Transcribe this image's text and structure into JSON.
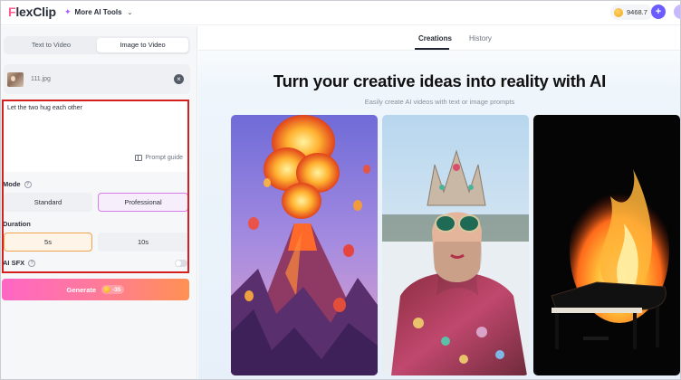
{
  "app": {
    "logo_prefix": "F",
    "logo_text": "lexClip",
    "tools_label": "More AI Tools",
    "credits": "9468.7",
    "icons": [
      "sparkle-icon",
      "chevron-down-icon",
      "coin-icon",
      "plus-icon"
    ]
  },
  "left_panel": {
    "tabs": [
      {
        "label": "Text to Video",
        "active": false
      },
      {
        "label": "Image to Video",
        "active": true
      }
    ],
    "upload": {
      "file_name": "111.jpg"
    },
    "prompt": {
      "value": "Let the two hug each other",
      "guide_label": "Prompt guide"
    },
    "mode": {
      "label": "Mode",
      "options": [
        {
          "label": "Standard",
          "selected": false
        },
        {
          "label": "Professional",
          "selected": true
        }
      ]
    },
    "duration": {
      "label": "Duration",
      "options": [
        {
          "label": "5s",
          "selected": true
        },
        {
          "label": "10s",
          "selected": false
        }
      ]
    },
    "sfx": {
      "label": "AI SFX",
      "enabled": false
    },
    "generate": {
      "label": "Generate",
      "cost": "-35"
    }
  },
  "right_panel": {
    "tabs": [
      {
        "label": "Creations",
        "active": true
      },
      {
        "label": "History",
        "active": false
      }
    ],
    "headline": "Turn your creative ideas into reality with AI",
    "subline": "Easily create AI videos with text or image prompts",
    "gallery": [
      {
        "subject": "volcano with hot air balloons"
      },
      {
        "subject": "woman in jeweled crown and sunglasses"
      },
      {
        "subject": "grand piano on fire"
      }
    ]
  },
  "colors": {
    "highlight_box": "#d62020",
    "generate_gradient_start": "#ff66c4",
    "generate_gradient_end": "#ff9153",
    "accent_purple": "#6b5cff"
  }
}
